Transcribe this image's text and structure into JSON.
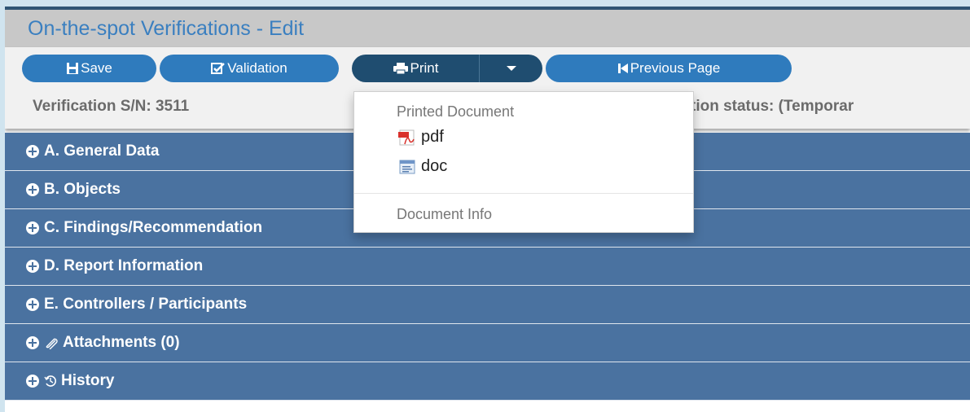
{
  "page": {
    "title": "On-the-spot Verifications - Edit"
  },
  "toolbar": {
    "save_label": "Save",
    "validation_label": "Validation",
    "print_label": "Print",
    "previous_label": "Previous Page"
  },
  "info": {
    "serial": "Verification S/N: 3511",
    "status_partial": "tion status: (Temporar"
  },
  "print_menu": {
    "header_printed": "Printed Document",
    "items": [
      {
        "label": "pdf",
        "icon": "pdf-file-icon"
      },
      {
        "label": "doc",
        "icon": "doc-file-icon"
      }
    ],
    "header_info": "Document Info"
  },
  "panels": [
    {
      "label": "A. General Data"
    },
    {
      "label": "B. Objects"
    },
    {
      "label": "C. Findings/Recommendation"
    },
    {
      "label": "D. Report Information"
    },
    {
      "label": "E. Controllers / Participants"
    },
    {
      "label": "Attachments (0)",
      "icon": "paperclip-icon"
    },
    {
      "label": "History",
      "icon": "history-icon"
    }
  ],
  "colors": {
    "title": "#3a7fc0",
    "button": "#2f7bbd",
    "button_active": "#1f4d70",
    "panel": "#4a72a0"
  }
}
